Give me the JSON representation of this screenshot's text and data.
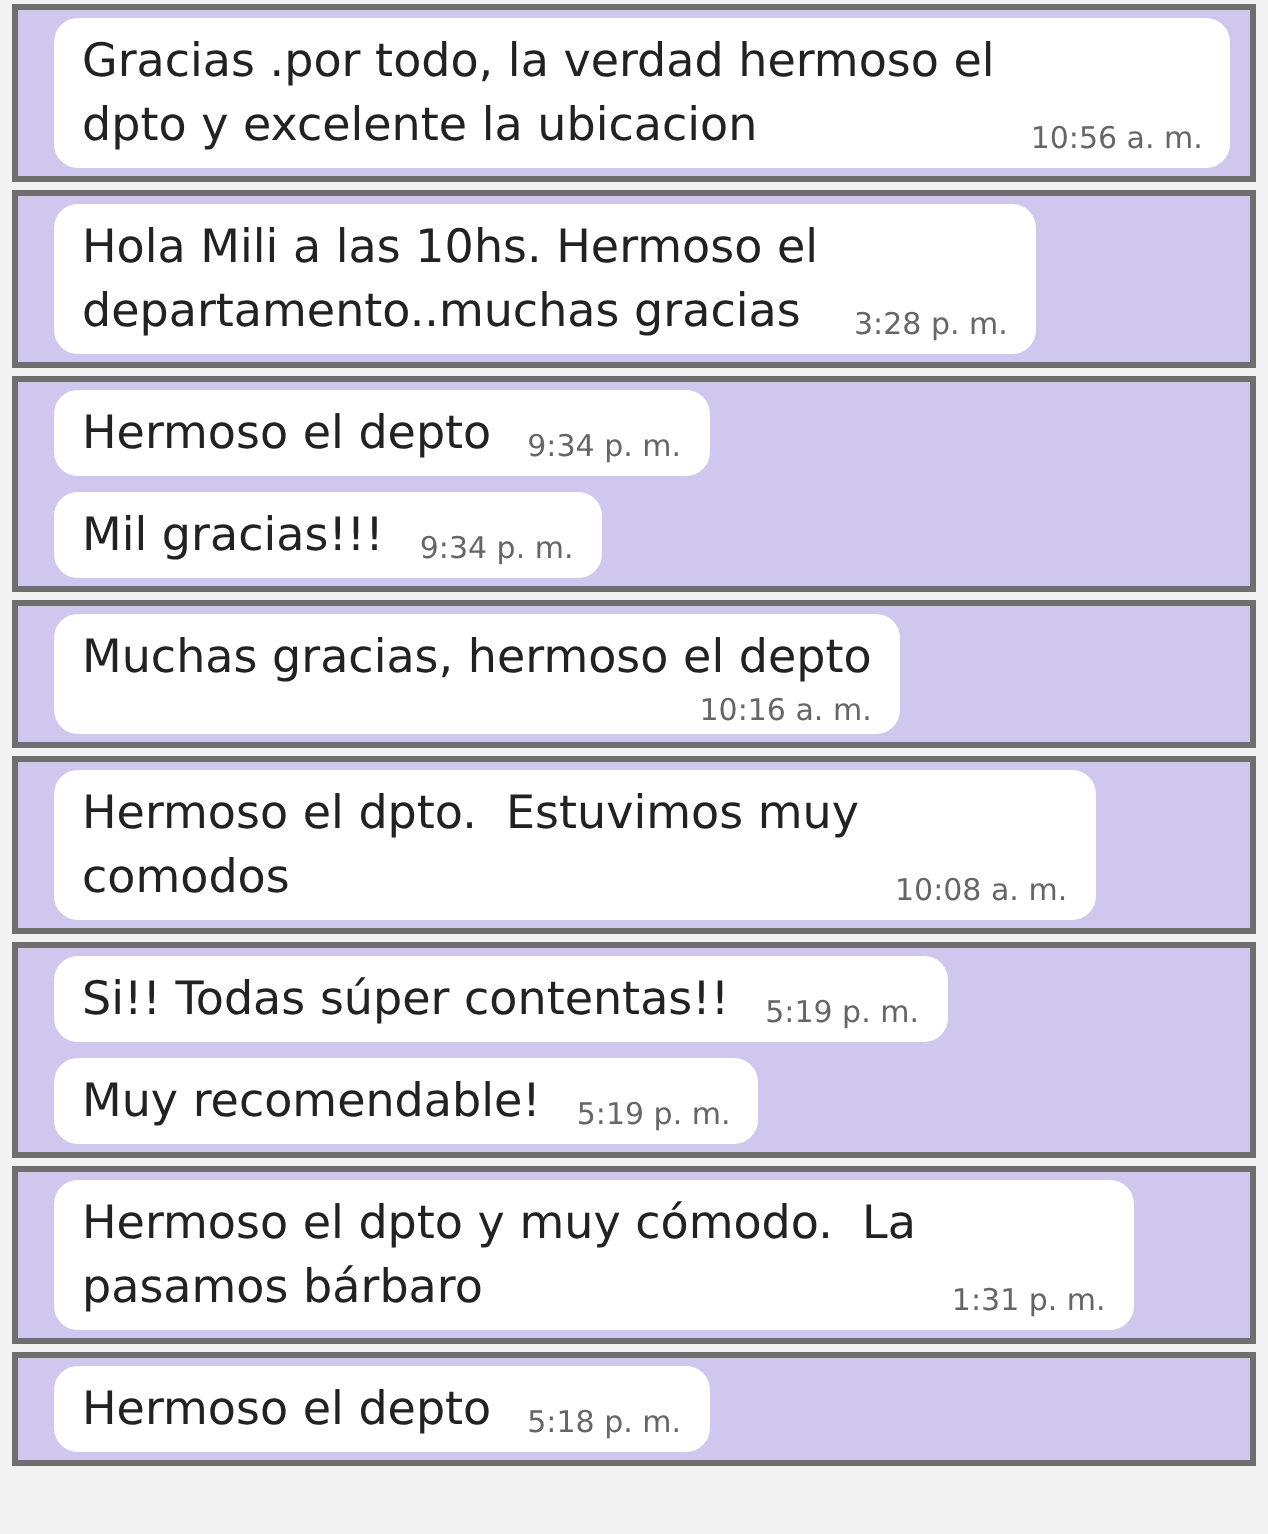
{
  "panels": [
    {
      "bubbles": [
        {
          "kind": "inline",
          "lines": [
            "Gracias .por todo, la verdad hermoso el",
            "dpto y excelente la ubicacion"
          ],
          "time": "10:56 a. m."
        }
      ]
    },
    {
      "bubbles": [
        {
          "kind": "inline",
          "lines": [
            "Hola Mili a las 10hs. Hermoso el",
            "departamento..muchas gracias"
          ],
          "time": "3:28 p. m."
        }
      ]
    },
    {
      "bubbles": [
        {
          "kind": "inline",
          "lines": [
            "Hermoso el depto"
          ],
          "time": "9:34 p. m."
        },
        {
          "kind": "inline",
          "lines": [
            "Mil gracias!!!"
          ],
          "time": "9:34 p. m."
        }
      ]
    },
    {
      "bubbles": [
        {
          "kind": "below",
          "lines": [
            "Muchas gracias, hermoso el depto"
          ],
          "time": "10:16 a. m."
        }
      ]
    },
    {
      "bubbles": [
        {
          "kind": "inline",
          "lines": [
            "Hermoso el dpto.  Estuvimos muy",
            "comodos"
          ],
          "time": "10:08 a. m."
        }
      ]
    },
    {
      "bubbles": [
        {
          "kind": "inline",
          "lines": [
            "Si!! Todas súper contentas!!"
          ],
          "time": "5:19 p. m."
        },
        {
          "kind": "inline",
          "lines": [
            "Muy recomendable!"
          ],
          "time": "5:19 p. m."
        }
      ]
    },
    {
      "bubbles": [
        {
          "kind": "inline",
          "lines": [
            "Hermoso el dpto y muy cómodo.  La",
            "pasamos bárbaro"
          ],
          "time": "1:31 p. m."
        }
      ]
    },
    {
      "bubbles": [
        {
          "kind": "inline",
          "lines": [
            "Hermoso el depto"
          ],
          "time": "5:18 p. m."
        }
      ]
    }
  ]
}
